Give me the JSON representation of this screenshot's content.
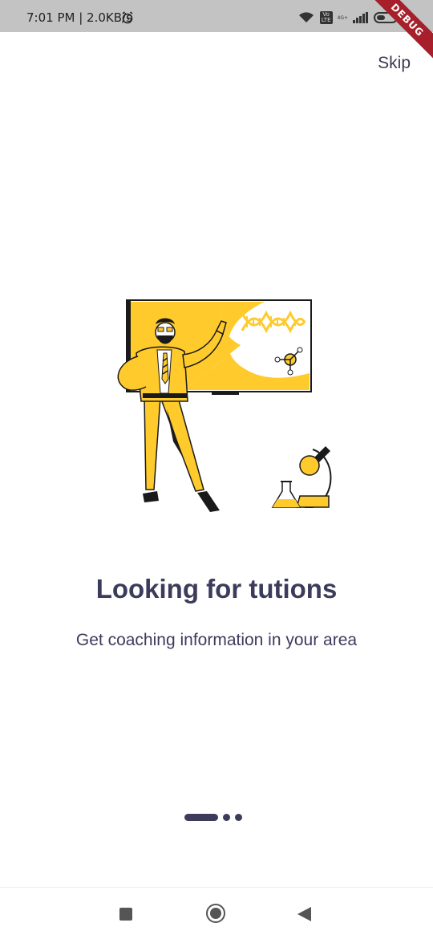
{
  "status_bar": {
    "time": "7:01 PM | 2.0KB/s",
    "volte": "Vo\nLTE",
    "network": "4G+",
    "battery": "5"
  },
  "debug_banner": "DEBUG",
  "onboarding": {
    "skip_label": "Skip",
    "title": "Looking for tutions",
    "subtitle": "Get coaching information in your area",
    "page_count": 3,
    "current_page": 1
  },
  "colors": {
    "accent_yellow": "#FFCA2C",
    "text_dark": "#3D3B5C",
    "status_bar_bg": "#C3C3C3"
  },
  "icons": {
    "alarm": "alarm-clock-icon",
    "wifi": "wifi-icon",
    "signal": "signal-icon",
    "battery": "battery-icon",
    "recents": "square-icon",
    "home": "circle-icon",
    "back": "triangle-back-icon"
  }
}
